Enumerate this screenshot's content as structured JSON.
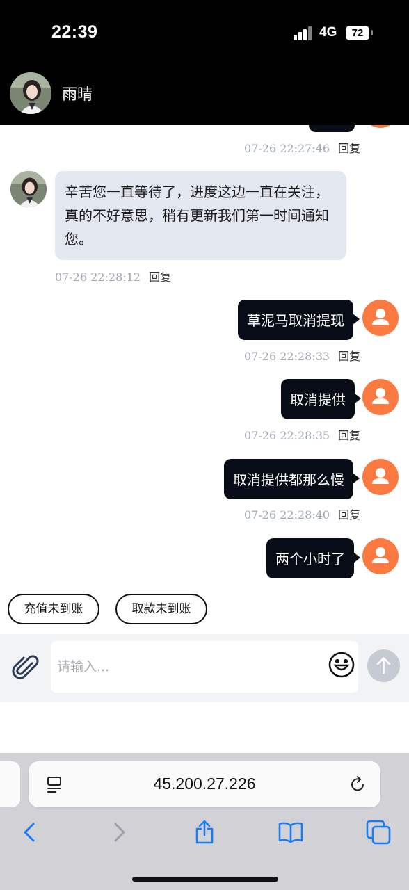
{
  "status_bar": {
    "time": "22:39",
    "network": "4G",
    "battery": "72"
  },
  "header": {
    "contact_name": "雨晴"
  },
  "messages": [
    {
      "direction": "sent",
      "text": "",
      "time": "07-26 22:27:46",
      "reply": "回复"
    },
    {
      "direction": "received",
      "text": "辛苦您一直等待了，进度这边一直在关注，真的不好意思，稍有更新我们第一时间通知您。",
      "time": "07-26 22:28:12",
      "reply": "回复"
    },
    {
      "direction": "sent",
      "text": "草泥马取消提现",
      "time": "07-26 22:28:33",
      "reply": "回复"
    },
    {
      "direction": "sent",
      "text": "取消提供",
      "time": "07-26 22:28:35",
      "reply": "回复"
    },
    {
      "direction": "sent",
      "text": "取消提供都那么慢",
      "time": "07-26 22:28:40",
      "reply": "回复"
    },
    {
      "direction": "sent",
      "text": "两个小时了",
      "time": "",
      "reply": ""
    }
  ],
  "quick_replies": [
    "充值未到账",
    "取款未到账"
  ],
  "input": {
    "placeholder": "请输入..."
  },
  "browser": {
    "url": "45.200.27.226"
  },
  "icons": {
    "attach": "paperclip-icon",
    "emoji": "smiley-icon",
    "send": "arrow-up-icon",
    "tabs": "page-menu-icon",
    "reload": "reload-icon",
    "back": "chevron-left-icon",
    "forward": "chevron-right-icon",
    "share": "share-icon",
    "bookmarks": "book-icon",
    "tab_switcher": "tabs-icon"
  },
  "colors": {
    "accent": "#fb7a41",
    "sent_bubble": "#080c16",
    "received_bubble": "#e3e8f0",
    "ios_blue": "#1a7cf5"
  }
}
